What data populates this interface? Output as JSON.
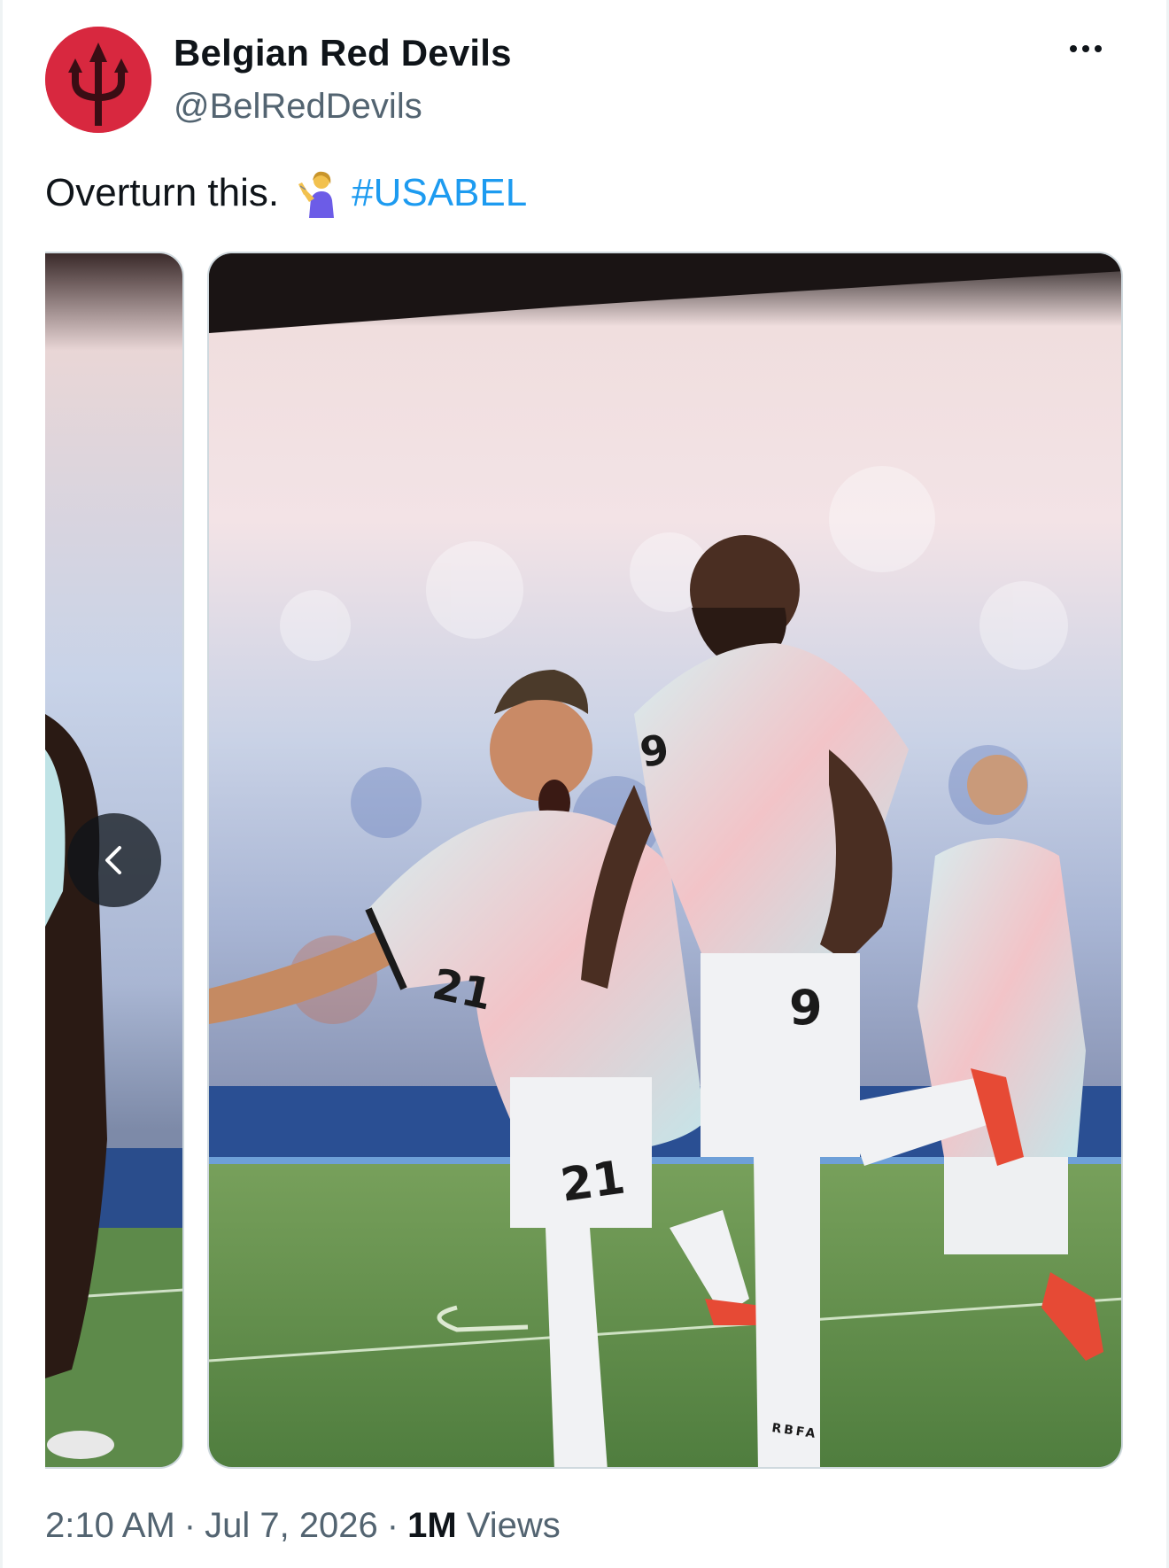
{
  "author": {
    "display_name": "Belgian Red Devils",
    "handle": "@BelRedDevils",
    "avatar_icon": "trident-logo-icon",
    "avatar_color": "#d8283f"
  },
  "tweet": {
    "text": "Overturn this.",
    "emoji_icon": "woman-tipping-hand-emoji-icon",
    "hashtag": "#USABEL"
  },
  "media": {
    "count_visible": 2,
    "prev_button_icon": "chevron-left-icon",
    "main_photo_jersey_numbers": [
      "21",
      "9"
    ],
    "sock_text": "RBFA"
  },
  "meta": {
    "time": "2:10 AM",
    "date": "Jul 7, 2026",
    "views_count": "1M",
    "views_label": "Views"
  },
  "colors": {
    "link": "#1d9bf0",
    "secondary_text": "#536471",
    "primary_text": "#0f1419"
  }
}
